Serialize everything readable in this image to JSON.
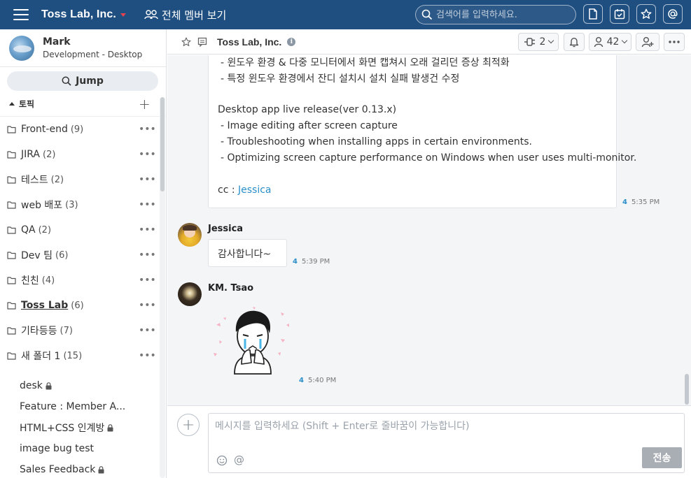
{
  "topbar": {
    "team_name": "Toss Lab, Inc.",
    "all_members_label": "전체 멤버 보기",
    "search_placeholder": "검색어를 입력하세요.",
    "icons": [
      "file-icon",
      "calendar-check-icon",
      "star-icon",
      "at-icon"
    ],
    "bg_color": "#1f4f81",
    "caret_color": "#e8424f"
  },
  "profile": {
    "name": "Mark",
    "subtitle": "Development - Desktop"
  },
  "jump_label": "Jump",
  "topics_header": "토픽",
  "folders": [
    {
      "label": "Front-end",
      "count": "(9)"
    },
    {
      "label": "JIRA",
      "count": "(2)"
    },
    {
      "label": "테스트",
      "count": "(2)"
    },
    {
      "label": "web 배포",
      "count": "(3)"
    },
    {
      "label": "QA",
      "count": "(2)"
    },
    {
      "label": "Dev 팀",
      "count": "(6)"
    },
    {
      "label": "친친",
      "count": "(4)"
    },
    {
      "label": "Toss Lab",
      "count": "(6)"
    },
    {
      "label": "기타등등",
      "count": "(7)"
    },
    {
      "label": "새 폴더 1",
      "count": "(15)"
    }
  ],
  "more_symbol": "•••",
  "topics": [
    {
      "label": "desk",
      "private": true
    },
    {
      "label": "Feature : Member A...",
      "private": false
    },
    {
      "label": "HTML+CSS 인계방",
      "private": true
    },
    {
      "label": "image bug test",
      "private": false
    },
    {
      "label": "Sales Feedback",
      "private": true
    }
  ],
  "chat_header": {
    "title": "Toss Lab, Inc.",
    "info_symbol": "i",
    "connect_count": "2",
    "member_count": "42"
  },
  "messages": {
    "first": {
      "lines": [
        "- 윈도우 환경 & 다중 모니터에서 화면 캡쳐시 오래 걸리던 증상 최적화",
        "- 특정 윈도우 환경에서 잔디 설치시 설치 실패 발생건 수정",
        "Desktop app live release(ver 0.13.x)",
        "- Image editing after screen capture",
        "- Troubleshooting when installing apps in certain environments.",
        "- Optimizing screen capture performance on Windows when user uses multi-monitor."
      ],
      "cc_prefix": "cc : ",
      "cc_mention": "Jessica",
      "unread": "4",
      "time": "5:35 PM"
    },
    "jessica": {
      "sender": "Jessica",
      "text": "감사합니다~",
      "unread": "4",
      "time": "5:39 PM"
    },
    "tsao": {
      "sender": "KM. Tsao",
      "unread": "4",
      "time": "5:40 PM"
    }
  },
  "composer": {
    "add_symbol": "+",
    "placeholder": "메시지를 입력하세요 (Shift + Enter로 줄바꿈이 가능합니다)",
    "at_symbol": "@",
    "send_label": "전송"
  }
}
